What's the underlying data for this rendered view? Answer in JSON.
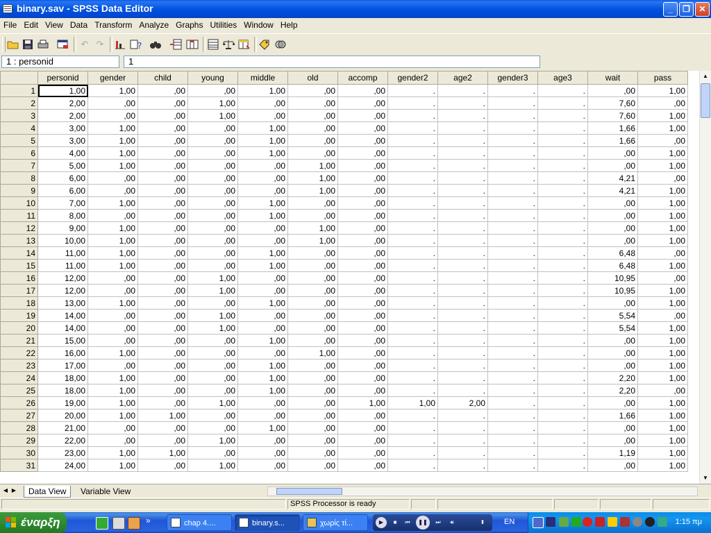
{
  "window": {
    "title": "binary.sav - SPSS Data Editor"
  },
  "menu": [
    "File",
    "Edit",
    "View",
    "Data",
    "Transform",
    "Analyze",
    "Graphs",
    "Utilities",
    "Window",
    "Help"
  ],
  "cell_editor": {
    "reference": "1 : personid",
    "value": "1"
  },
  "columns": [
    "personid",
    "gender",
    "child",
    "young",
    "middle",
    "old",
    "accomp",
    "gender2",
    "age2",
    "gender3",
    "age3",
    "wait",
    "pass"
  ],
  "rows": [
    [
      "1,00",
      "1,00",
      ",00",
      ",00",
      "1,00",
      ",00",
      ",00",
      ".",
      ".",
      ".",
      ".",
      ",00",
      "1,00"
    ],
    [
      "2,00",
      ",00",
      ",00",
      "1,00",
      ",00",
      ",00",
      ",00",
      ".",
      ".",
      ".",
      ".",
      "7,60",
      ",00"
    ],
    [
      "2,00",
      ",00",
      ",00",
      "1,00",
      ",00",
      ",00",
      ",00",
      ".",
      ".",
      ".",
      ".",
      "7,60",
      "1,00"
    ],
    [
      "3,00",
      "1,00",
      ",00",
      ",00",
      "1,00",
      ",00",
      ",00",
      ".",
      ".",
      ".",
      ".",
      "1,66",
      "1,00"
    ],
    [
      "3,00",
      "1,00",
      ",00",
      ",00",
      "1,00",
      ",00",
      ",00",
      ".",
      ".",
      ".",
      ".",
      "1,66",
      ",00"
    ],
    [
      "4,00",
      "1,00",
      ",00",
      ",00",
      "1,00",
      ",00",
      ",00",
      ".",
      ".",
      ".",
      ".",
      ",00",
      "1,00"
    ],
    [
      "5,00",
      "1,00",
      ",00",
      ",00",
      ",00",
      "1,00",
      ",00",
      ".",
      ".",
      ".",
      ".",
      ",00",
      "1,00"
    ],
    [
      "6,00",
      ",00",
      ",00",
      ",00",
      ",00",
      "1,00",
      ",00",
      ".",
      ".",
      ".",
      ".",
      "4,21",
      ",00"
    ],
    [
      "6,00",
      ",00",
      ",00",
      ",00",
      ",00",
      "1,00",
      ",00",
      ".",
      ".",
      ".",
      ".",
      "4,21",
      "1,00"
    ],
    [
      "7,00",
      "1,00",
      ",00",
      ",00",
      "1,00",
      ",00",
      ",00",
      ".",
      ".",
      ".",
      ".",
      ",00",
      "1,00"
    ],
    [
      "8,00",
      ",00",
      ",00",
      ",00",
      "1,00",
      ",00",
      ",00",
      ".",
      ".",
      ".",
      ".",
      ",00",
      "1,00"
    ],
    [
      "9,00",
      "1,00",
      ",00",
      ",00",
      ",00",
      "1,00",
      ",00",
      ".",
      ".",
      ".",
      ".",
      ",00",
      "1,00"
    ],
    [
      "10,00",
      "1,00",
      ",00",
      ",00",
      ",00",
      "1,00",
      ",00",
      ".",
      ".",
      ".",
      ".",
      ",00",
      "1,00"
    ],
    [
      "11,00",
      "1,00",
      ",00",
      ",00",
      "1,00",
      ",00",
      ",00",
      ".",
      ".",
      ".",
      ".",
      "6,48",
      ",00"
    ],
    [
      "11,00",
      "1,00",
      ",00",
      ",00",
      "1,00",
      ",00",
      ",00",
      ".",
      ".",
      ".",
      ".",
      "6,48",
      "1,00"
    ],
    [
      "12,00",
      ",00",
      ",00",
      "1,00",
      ",00",
      ",00",
      ",00",
      ".",
      ".",
      ".",
      ".",
      "10,95",
      ",00"
    ],
    [
      "12,00",
      ",00",
      ",00",
      "1,00",
      ",00",
      ",00",
      ",00",
      ".",
      ".",
      ".",
      ".",
      "10,95",
      "1,00"
    ],
    [
      "13,00",
      "1,00",
      ",00",
      ",00",
      "1,00",
      ",00",
      ",00",
      ".",
      ".",
      ".",
      ".",
      ",00",
      "1,00"
    ],
    [
      "14,00",
      ",00",
      ",00",
      "1,00",
      ",00",
      ",00",
      ",00",
      ".",
      ".",
      ".",
      ".",
      "5,54",
      ",00"
    ],
    [
      "14,00",
      ",00",
      ",00",
      "1,00",
      ",00",
      ",00",
      ",00",
      ".",
      ".",
      ".",
      ".",
      "5,54",
      "1,00"
    ],
    [
      "15,00",
      ",00",
      ",00",
      ",00",
      "1,00",
      ",00",
      ",00",
      ".",
      ".",
      ".",
      ".",
      ",00",
      "1,00"
    ],
    [
      "16,00",
      "1,00",
      ",00",
      ",00",
      ",00",
      "1,00",
      ",00",
      ".",
      ".",
      ".",
      ".",
      ",00",
      "1,00"
    ],
    [
      "17,00",
      ",00",
      ",00",
      ",00",
      "1,00",
      ",00",
      ",00",
      ".",
      ".",
      ".",
      ".",
      ",00",
      "1,00"
    ],
    [
      "18,00",
      "1,00",
      ",00",
      ",00",
      "1,00",
      ",00",
      ",00",
      ".",
      ".",
      ".",
      ".",
      "2,20",
      "1,00"
    ],
    [
      "18,00",
      "1,00",
      ",00",
      ",00",
      "1,00",
      ",00",
      ",00",
      ".",
      ".",
      ".",
      ".",
      "2,20",
      ",00"
    ],
    [
      "19,00",
      "1,00",
      ",00",
      "1,00",
      ",00",
      ",00",
      "1,00",
      "1,00",
      "2,00",
      ".",
      ".",
      ",00",
      "1,00"
    ],
    [
      "20,00",
      "1,00",
      "1,00",
      ",00",
      ",00",
      ",00",
      ",00",
      ".",
      ".",
      ".",
      ".",
      "1,66",
      "1,00"
    ],
    [
      "21,00",
      ",00",
      ",00",
      ",00",
      "1,00",
      ",00",
      ",00",
      ".",
      ".",
      ".",
      ".",
      ",00",
      "1,00"
    ],
    [
      "22,00",
      ",00",
      ",00",
      "1,00",
      ",00",
      ",00",
      ",00",
      ".",
      ".",
      ".",
      ".",
      ",00",
      "1,00"
    ],
    [
      "23,00",
      "1,00",
      "1,00",
      ",00",
      ",00",
      ",00",
      ",00",
      ".",
      ".",
      ".",
      ".",
      "1,19",
      "1,00"
    ],
    [
      "24,00",
      "1,00",
      ",00",
      "1,00",
      ",00",
      ",00",
      ",00",
      ".",
      ".",
      ".",
      ".",
      ",00",
      "1,00"
    ]
  ],
  "tabs": {
    "data_view": "Data View",
    "variable_view": "Variable View"
  },
  "status": {
    "message": "SPSS Processor  is ready"
  },
  "taskbar": {
    "start_label": "έναρξη",
    "tasks": [
      "chap 4....",
      "binary.s...",
      "χωρίς τί..."
    ],
    "language": "EN",
    "clock": "1:15 πμ"
  },
  "colors": {
    "titlebar": "#0053e0",
    "taskbar": "#2663e0",
    "start": "#2f8c2f",
    "chrome": "#ece9d8"
  }
}
